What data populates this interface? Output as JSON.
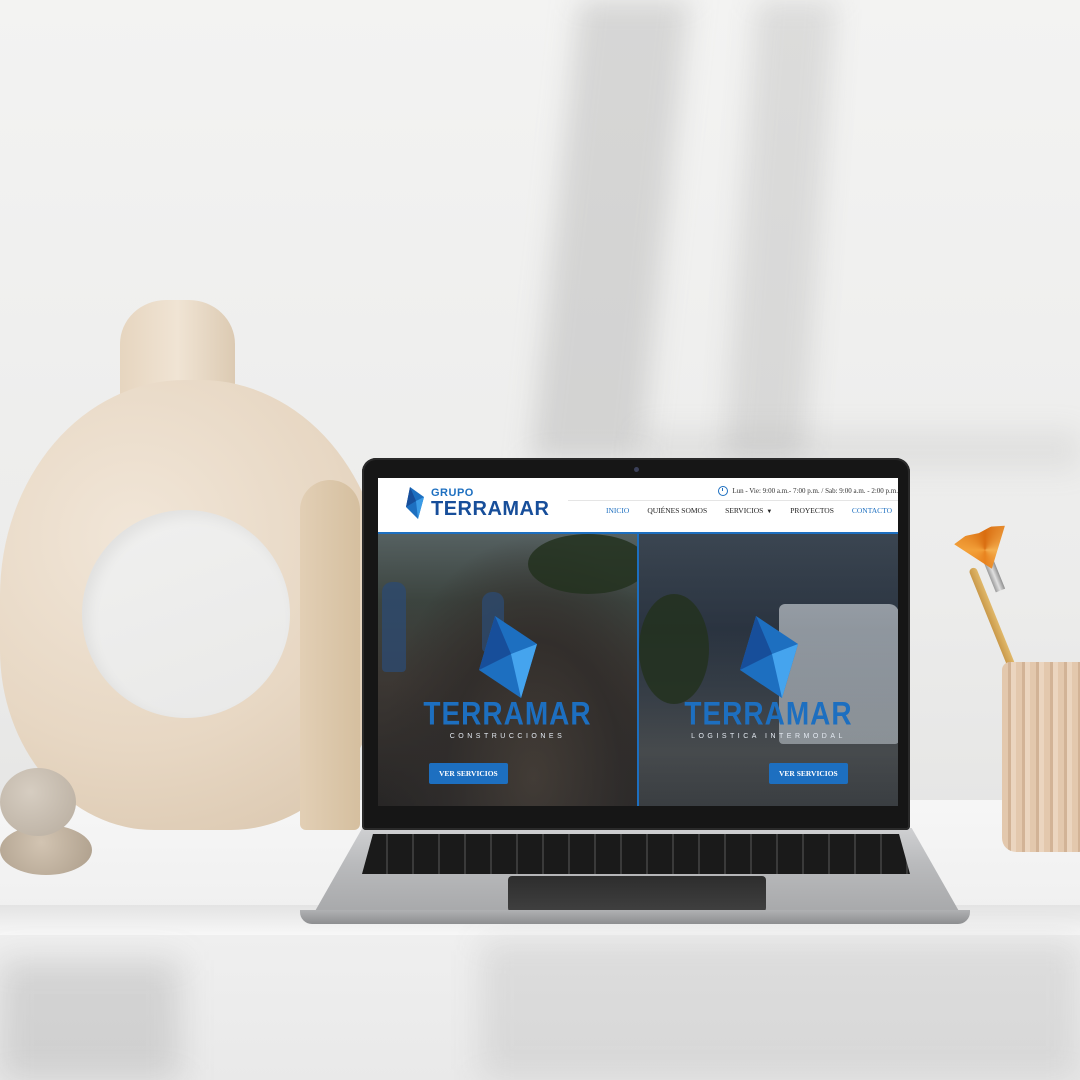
{
  "site": {
    "logo": {
      "small": "GRUPO",
      "big": "TERRAMAR"
    },
    "hours": "Lun - Vie: 9:00 a.m.- 7:00 p.m. / Sab: 9:00 a.m. - 2:00 p.m.",
    "nav": {
      "items": [
        {
          "label": "INICIO",
          "active": true
        },
        {
          "label": "QUIÉNES SOMOS"
        },
        {
          "label": "SERVICIOS",
          "has_dropdown": true
        },
        {
          "label": "PROYECTOS"
        },
        {
          "label": "CONTACTO"
        }
      ]
    },
    "panels": [
      {
        "name": "TERRAMAR",
        "subtitle": "CONSTRUCCIONES",
        "button": "VER SERVICIOS"
      },
      {
        "name": "TERRAMAR",
        "subtitle": "LOGISTICA INTERMODAL",
        "button": "VER SERVICIOS"
      }
    ]
  },
  "colors": {
    "brand_blue": "#1d6fc0",
    "brand_navy": "#174e9a",
    "screen_bezel": "#161616"
  },
  "icons": {
    "clock": "clock-icon",
    "caret": "chevron-down-icon",
    "logo": "terramar-diamond-logo"
  }
}
